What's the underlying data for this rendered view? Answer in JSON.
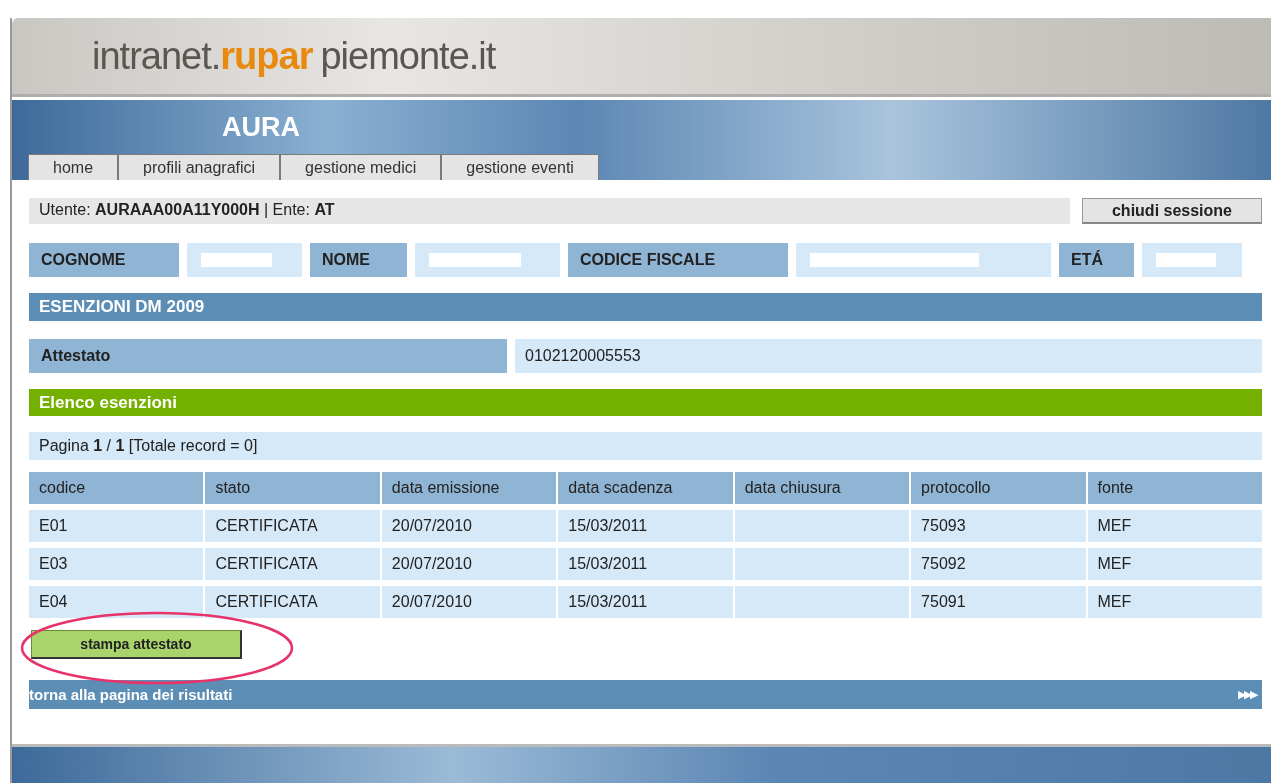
{
  "header": {
    "logo_prefix": "intranet.",
    "logo_brand": "rupar",
    "logo_suffix": "piemonte.it"
  },
  "app_title": "AURA",
  "tabs": [
    {
      "label": "home",
      "selected": false
    },
    {
      "label": "profili anagrafici",
      "selected": false
    },
    {
      "label": "gestione medici",
      "selected": false
    },
    {
      "label": "gestione eventi",
      "selected": false
    }
  ],
  "user_bar": {
    "text": "Utente: **AURAAA00A11Y000H** | Ente: **AT**",
    "logout": "chiudi sessione"
  },
  "patient": [
    {
      "label": "COGNOME"
    },
    {
      "label": "NOME"
    },
    {
      "label": "CODICE FISCALE"
    },
    {
      "label": "ETÁ"
    }
  ],
  "section_title": "ESENZIONI DM 2009",
  "attestato": {
    "label": "Attestato",
    "value": "0102120005553"
  },
  "list_title": "Elenco esenzioni",
  "pagination": "Pagina **1** / **1** [Totale record = 0]",
  "table": {
    "columns": [
      "codice",
      "stato",
      "data emissione",
      "data scadenza",
      "data chiusura",
      "protocollo",
      "fonte"
    ],
    "rows": [
      [
        "E01",
        "CERTIFICATA",
        "20/07/2010",
        "15/03/2011",
        "",
        "75093",
        "MEF"
      ],
      [
        "E03",
        "CERTIFICATA",
        "20/07/2010",
        "15/03/2011",
        "",
        "75092",
        "MEF"
      ],
      [
        "E04",
        "CERTIFICATA",
        "20/07/2010",
        "15/03/2011",
        "",
        "75091",
        "MEF"
      ]
    ]
  },
  "print_button": "stampa attestato",
  "back_bar": {
    "link": "torna alla pagina dei risultati",
    "arrows": "▶▶▶"
  }
}
